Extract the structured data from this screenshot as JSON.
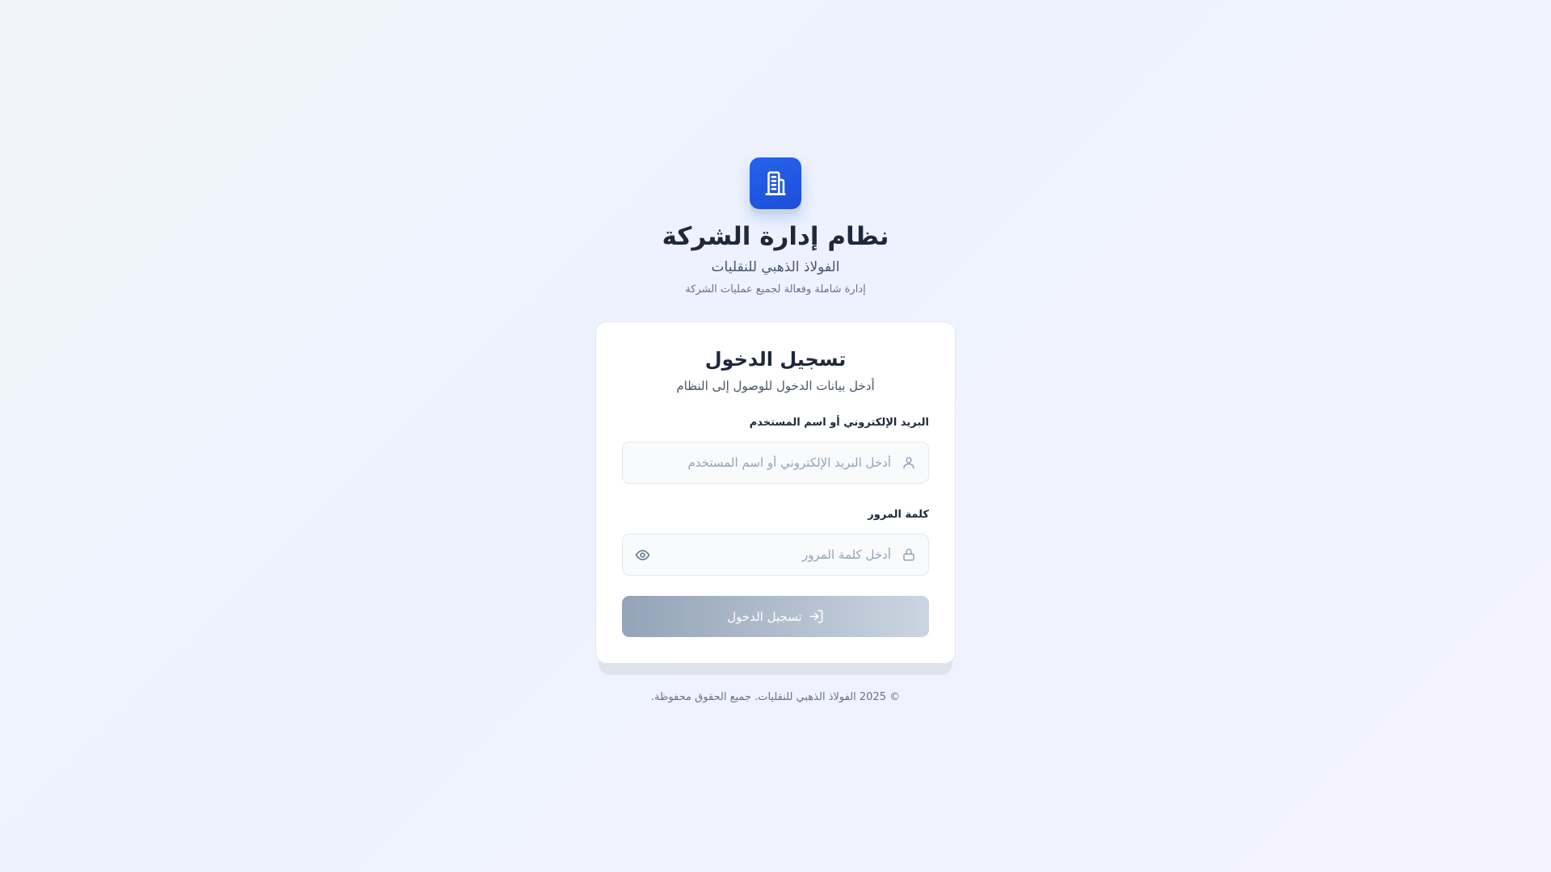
{
  "app": {
    "title": "نظام إدارة الشركة",
    "company": "الفولاذ الذهبي للنقليات",
    "tagline": "إدارة شاملة وفعالة لجميع عمليات الشركة",
    "logo_icon": "building-icon",
    "accent_color": "#2563eb"
  },
  "login": {
    "title": "تسجيل الدخول",
    "subtitle": "أدخل بيانات الدخول للوصول إلى النظام",
    "username_label": "البريد الإلكتروني أو اسم المستخدم",
    "username_placeholder": "أدخل البريد الإلكتروني أو اسم المستخدم",
    "username_value": "",
    "username_icon": "user-icon",
    "password_label": "كلمة المرور",
    "password_placeholder": "أدخل كلمة المرور",
    "password_value": "",
    "password_icon": "lock-icon",
    "toggle_icon": "eye-icon",
    "submit_label": "تسجيل الدخول",
    "submit_icon": "log-in-icon"
  },
  "footer": {
    "copyright": "© 2025 الفولاذ الذهبي للنقليات. جميع الحقوق محفوظة."
  }
}
